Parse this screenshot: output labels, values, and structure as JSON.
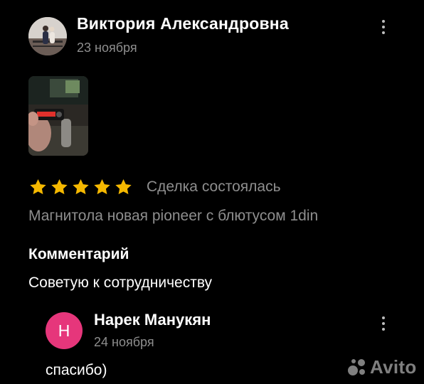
{
  "review": {
    "author_name": "Виктория Александровна",
    "date": "23 ноября",
    "rating": 5,
    "deal_status": "Сделка состоялась",
    "item_title": "Магнитола новая pioneer с блютусом 1din",
    "comment_heading": "Комментарий",
    "comment_text": "Советую к сотрудничеству"
  },
  "reply": {
    "avatar_letter": "Н",
    "avatar_color": "#e6367b",
    "author_name": "Нарек Манукян",
    "date": "24 ноября",
    "text": "спасибо)"
  },
  "watermark": {
    "text": "Avito",
    "icon": "avito-logo-icon"
  },
  "colors": {
    "background": "#000000",
    "star": "#f5b800",
    "muted_text": "#8e8e8e"
  }
}
